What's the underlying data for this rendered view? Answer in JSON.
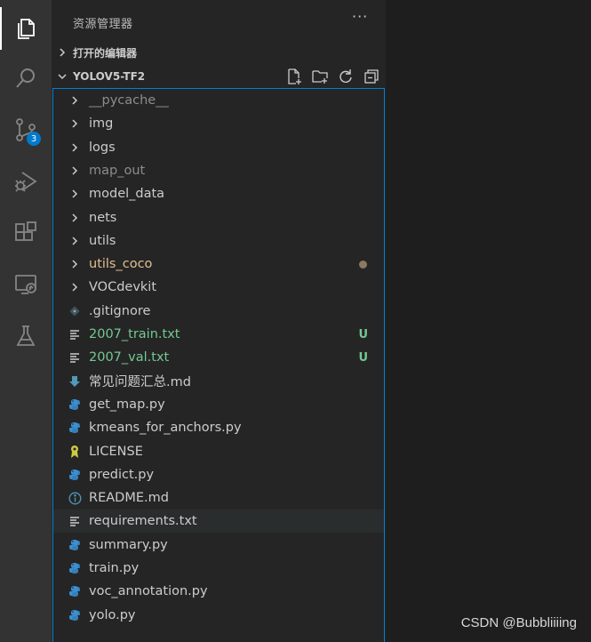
{
  "activity_bar": {
    "items": [
      {
        "name": "explorer-icon"
      },
      {
        "name": "search-icon"
      },
      {
        "name": "source-control-icon",
        "badge": "3"
      },
      {
        "name": "run-debug-icon"
      },
      {
        "name": "extensions-icon"
      },
      {
        "name": "remote-explorer-icon"
      },
      {
        "name": "testing-icon"
      }
    ]
  },
  "sidebar": {
    "title": "资源管理器",
    "more": "···",
    "open_editors_label": "打开的编辑器",
    "project_label": "YOLOV5-TF2"
  },
  "tree": [
    {
      "label": "__pycache__",
      "kind": "folder",
      "style": "dim"
    },
    {
      "label": "img",
      "kind": "folder"
    },
    {
      "label": "logs",
      "kind": "folder"
    },
    {
      "label": "map_out",
      "kind": "folder",
      "style": "dim"
    },
    {
      "label": "model_data",
      "kind": "folder"
    },
    {
      "label": "nets",
      "kind": "folder"
    },
    {
      "label": "utils",
      "kind": "folder"
    },
    {
      "label": "utils_coco",
      "kind": "folder",
      "style": "modified",
      "decoration": "dot"
    },
    {
      "label": "VOCdevkit",
      "kind": "folder"
    },
    {
      "label": ".gitignore",
      "kind": "git"
    },
    {
      "label": "2007_train.txt",
      "kind": "txt",
      "style": "untracked",
      "decoration": "U"
    },
    {
      "label": "2007_val.txt",
      "kind": "txt",
      "style": "untracked",
      "decoration": "U"
    },
    {
      "label": "常见问题汇总.md",
      "kind": "md-down"
    },
    {
      "label": "get_map.py",
      "kind": "py"
    },
    {
      "label": "kmeans_for_anchors.py",
      "kind": "py"
    },
    {
      "label": "LICENSE",
      "kind": "license"
    },
    {
      "label": "predict.py",
      "kind": "py"
    },
    {
      "label": "README.md",
      "kind": "info"
    },
    {
      "label": "requirements.txt",
      "kind": "txt",
      "hover": true
    },
    {
      "label": "summary.py",
      "kind": "py"
    },
    {
      "label": "train.py",
      "kind": "py"
    },
    {
      "label": "voc_annotation.py",
      "kind": "py"
    },
    {
      "label": "yolo.py",
      "kind": "py"
    }
  ],
  "watermark": "CSDN @Bubbliiiing",
  "colors": {
    "accent": "#007acc",
    "modified": "#e2c08d",
    "untracked": "#73c991",
    "python": "#3b8fd1"
  }
}
